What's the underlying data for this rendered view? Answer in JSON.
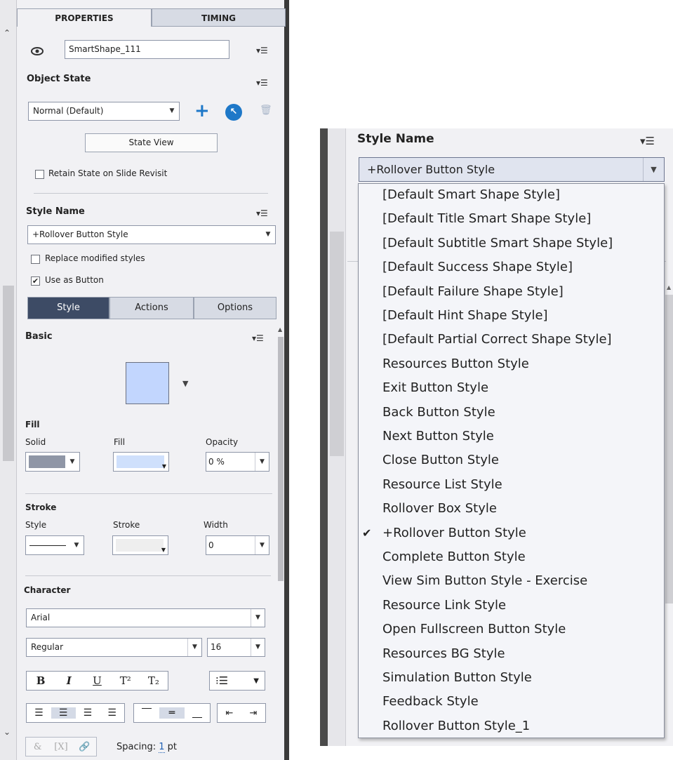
{
  "tabs": {
    "properties": "PROPERTIES",
    "timing": "TIMING"
  },
  "object": {
    "name_value": "SmartShape_111"
  },
  "object_state": {
    "title": "Object State",
    "state_value": "Normal (Default)",
    "state_view_label": "State View",
    "retain_label": "Retain State on Slide Revisit"
  },
  "style_name": {
    "title": "Style Name",
    "value": "+Rollover Button Style",
    "replace_label": "Replace modified styles",
    "use_as_button_label": "Use as Button"
  },
  "subtabs": {
    "style": "Style",
    "actions": "Actions",
    "options": "Options"
  },
  "basic": {
    "title": "Basic",
    "swatch_color": "#c2d6fe"
  },
  "fill": {
    "title": "Fill",
    "solid_label": "Solid",
    "fill_label": "Fill",
    "opacity_label": "Opacity",
    "opacity_value": "0 %",
    "solid_color": "#8f96a6",
    "fill_color": "#cfe0fc"
  },
  "stroke": {
    "title": "Stroke",
    "style_label": "Style",
    "stroke_label": "Stroke",
    "width_label": "Width",
    "width_value": "0"
  },
  "character": {
    "title": "Character",
    "font_value": "Arial",
    "weight_value": "Regular",
    "size_value": "16",
    "format_buttons": {
      "bold": "B",
      "italic": "I",
      "underline": "U",
      "superscript": "T²",
      "subscript": "T₂"
    }
  },
  "footer": {
    "spacing_label": "Spacing:",
    "spacing_value": "1",
    "spacing_unit": "pt"
  },
  "right_panel": {
    "title": "Style Name",
    "combo_value": "+Rollover Button Style",
    "checked_item": "+Rollover Button Style",
    "check_glyph": "✔",
    "items": [
      "[Default Smart Shape Style]",
      "[Default Title Smart Shape Style]",
      "[Default Subtitle Smart Shape Style]",
      "[Default Success Shape Style]",
      "[Default Failure Shape Style]",
      "[Default Hint Shape Style]",
      "[Default Partial Correct Shape Style]",
      "Resources Button Style",
      "Exit Button Style",
      "Back Button Style",
      "Next Button Style",
      "Close Button Style",
      "Resource List Style",
      "Rollover Box Style",
      "+Rollover Button Style",
      "Complete Button Style",
      "View Sim Button Style - Exercise",
      "Resource Link Style",
      "Open Fullscreen Button Style",
      "Resources BG Style",
      "Simulation Button Style",
      "Feedback Style",
      "Rollover Button Style_1"
    ]
  },
  "colors": {
    "accent_blue": "#1e78c8",
    "selected_tab": "#3d4b65"
  }
}
